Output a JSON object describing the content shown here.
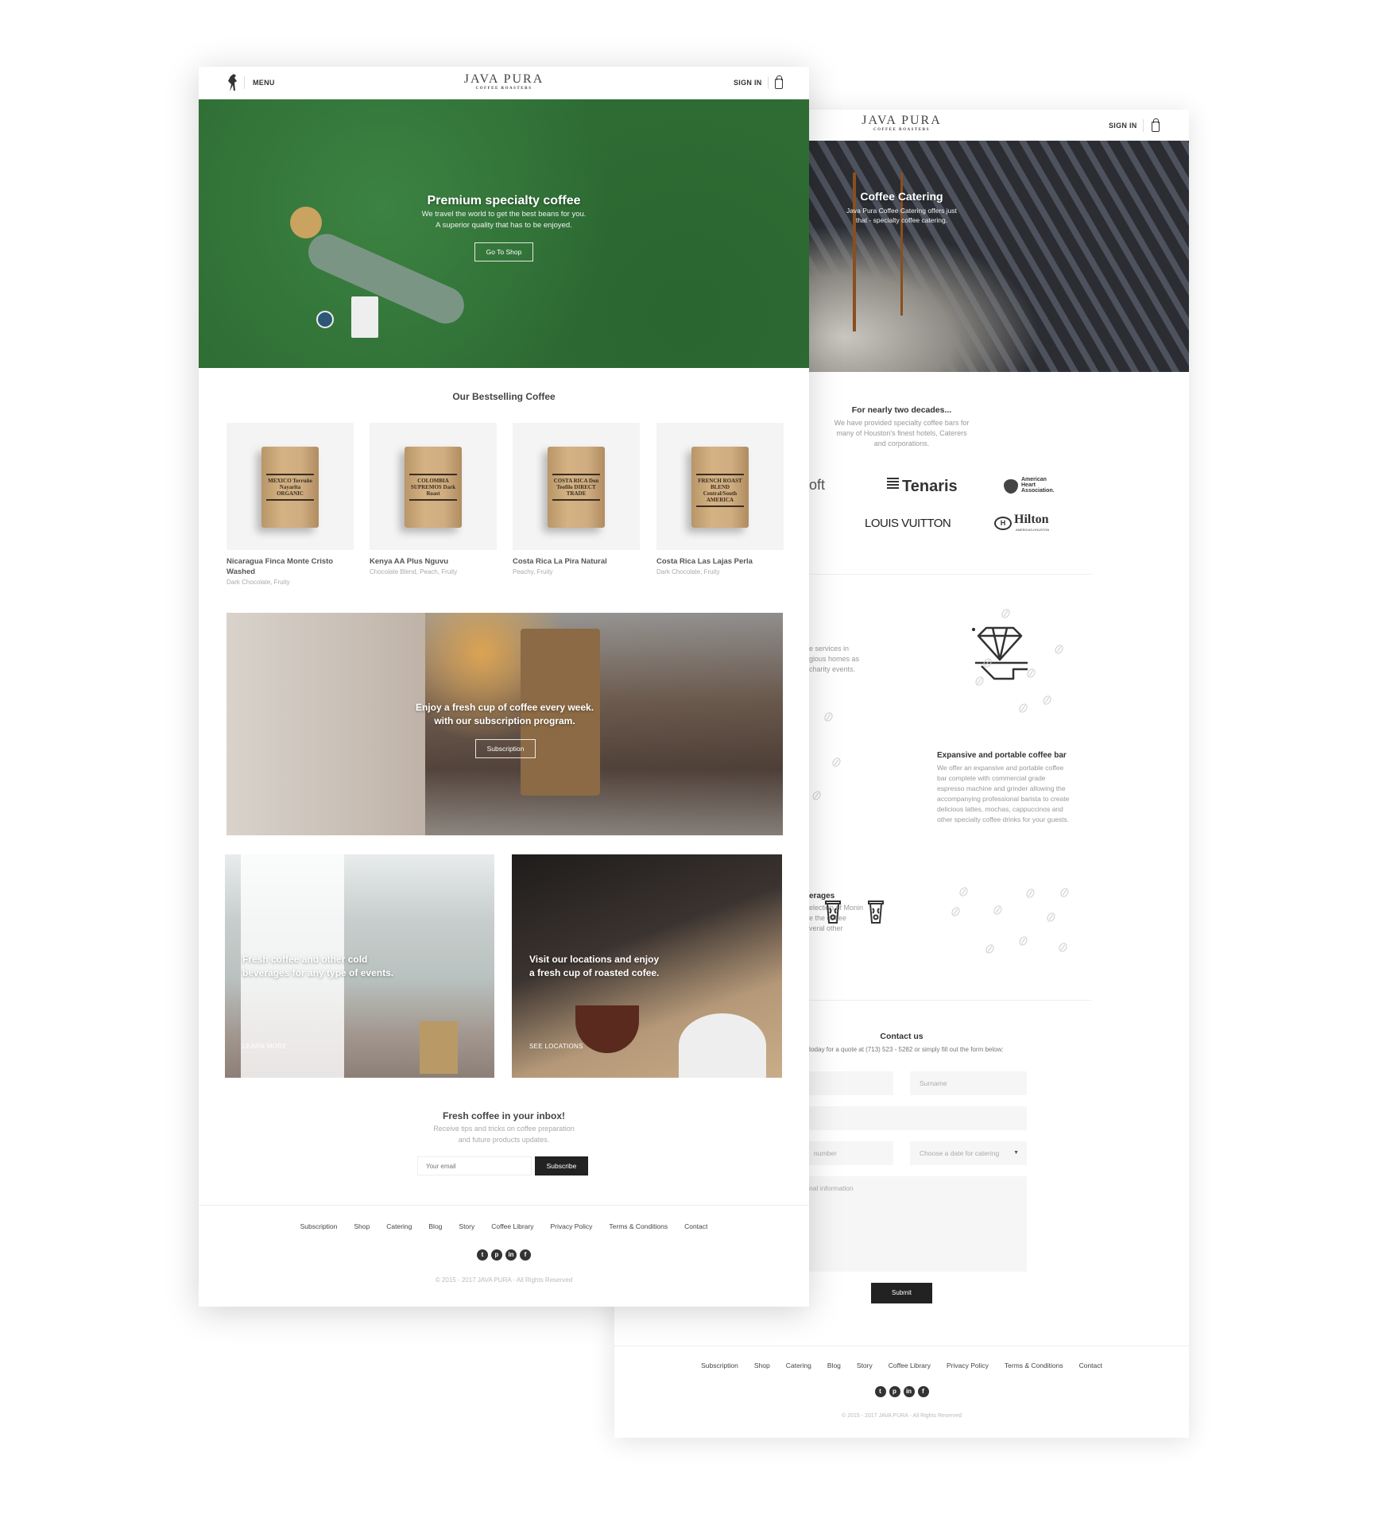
{
  "colors": {
    "hero_green": "#2f6e35",
    "dark_button": "#222222",
    "text_gray": "#999999"
  },
  "home": {
    "header": {
      "menu_label": "MENU",
      "brand": "JAVA PURA",
      "brand_sub": "COFFEE ROASTERS",
      "sign_in": "SIGN IN",
      "logo_icon": "horse-icon",
      "cart_icon": "shopping-bag-icon"
    },
    "hero": {
      "title": "Premium specialty coffee",
      "line1": "We travel the world to get the best beans for you.",
      "line2": "A superior quality that has to be enjoyed.",
      "button": "Go To Shop"
    },
    "bestselling": {
      "title": "Our Bestselling Coffee",
      "products": [
        {
          "name": "Nicaragua Finca Monte Cristo Washed",
          "notes": "Dark Chocolate, Fruity",
          "bag_label": "MEXICO Terruño Nayarita ORGANIC"
        },
        {
          "name": "Kenya AA Plus Nguvu",
          "notes": "Chocolate Blend, Peach, Fruity",
          "bag_label": "COLOMBIA SUPREMOS Dark Roast"
        },
        {
          "name": "Costa Rica La Pira Natural",
          "notes": "Peachy, Fruity",
          "bag_label": "COSTA RICA Don Teofilo DIRECT TRADE"
        },
        {
          "name": "Costa Rica Las Lajas Perla",
          "notes": "Dark Chocolate, Fruity",
          "bag_label": "FRENCH ROAST BLEND Central/South AMERICA"
        }
      ]
    },
    "subscription": {
      "line1": "Enjoy a fresh cup of coffee every week.",
      "line2": "with our subscription program.",
      "button": "Subscription"
    },
    "tiles": [
      {
        "line1": "Fresh coffee and other cold",
        "line2": "beverages for any type of events.",
        "link": "LEARN MORE"
      },
      {
        "line1": "Visit our locations and enjoy",
        "line2": "a fresh cup of roasted cofee.",
        "link": "SEE LOCATIONS"
      }
    ],
    "newsletter": {
      "title": "Fresh coffee in your inbox!",
      "line1": "Receive tips and tricks on coffee preparation",
      "line2": "and future products updates.",
      "email_placeholder": "Your email",
      "button": "Subscribe"
    },
    "footer": {
      "links": [
        "Subscription",
        "Shop",
        "Catering",
        "Blog",
        "Story",
        "Coffee Library",
        "Privacy Policy",
        "Terms & Conditions",
        "Contact"
      ],
      "social": [
        "twitter-icon",
        "pinterest-icon",
        "linkedin-icon",
        "facebook-icon"
      ],
      "copyright": "© 2015 - 2017 JAVA PURA - All Rights Reserved"
    }
  },
  "catering": {
    "header": {
      "brand": "JAVA PURA",
      "brand_sub": "COFFEE ROASTERS",
      "sign_in": "SIGN IN"
    },
    "hero": {
      "title": "Coffee Catering",
      "line1": "Java Pura Coffee Catering offers just",
      "line2": "that - specialty coffee catering."
    },
    "intro": {
      "title": "For nearly two decades...",
      "line1": "We have provided specialty coffee bars for",
      "line2": "many of Houston's finest hotels, Caterers",
      "line3": "and corporations."
    },
    "clients": {
      "partial": "oft",
      "tenaris": "Tenaris",
      "aha1": "American",
      "aha2": "Heart",
      "aha3": "Association.",
      "lv": "LOUIS VUITTON",
      "hilton": "Hilton",
      "hilton_sub": "AMERICAS-HOUSTON"
    },
    "section1": {
      "line1": "e services in",
      "line2": "gious homes as",
      "line3": "charity events.",
      "icon": "diamond-tray-icon"
    },
    "section2": {
      "title": "Expansive and portable coffee bar",
      "lines": [
        "We offer an expansive and portable coffee",
        "bar complete with commercial grade",
        "espresso machine and grinder allowing the",
        "accompanying professional barista to create",
        "delicious lattes, mochas, cappuccinos and",
        "other specialty coffee drinks for your guests."
      ]
    },
    "section3": {
      "title": "erages",
      "line1": "election of Monin",
      "line2": "e the coffee",
      "line3": "veral other",
      "icon": "coffee-cup-icon"
    },
    "contact": {
      "title": "Contact us",
      "subtitle": "today for a quote at (713) 523 - 5282 or simply fill out the form below:",
      "surname": "Surname",
      "phone": "number",
      "date": "Choose a date for catering",
      "info": "nal information",
      "submit": "Submit"
    },
    "footer": {
      "links": [
        "Subscription",
        "Shop",
        "Catering",
        "Blog",
        "Story",
        "Coffee Library",
        "Privacy Policy",
        "Terms & Conditions",
        "Contact"
      ],
      "copyright": "© 2015 - 2017 JAVA PURA - All Rights Reserved"
    }
  }
}
